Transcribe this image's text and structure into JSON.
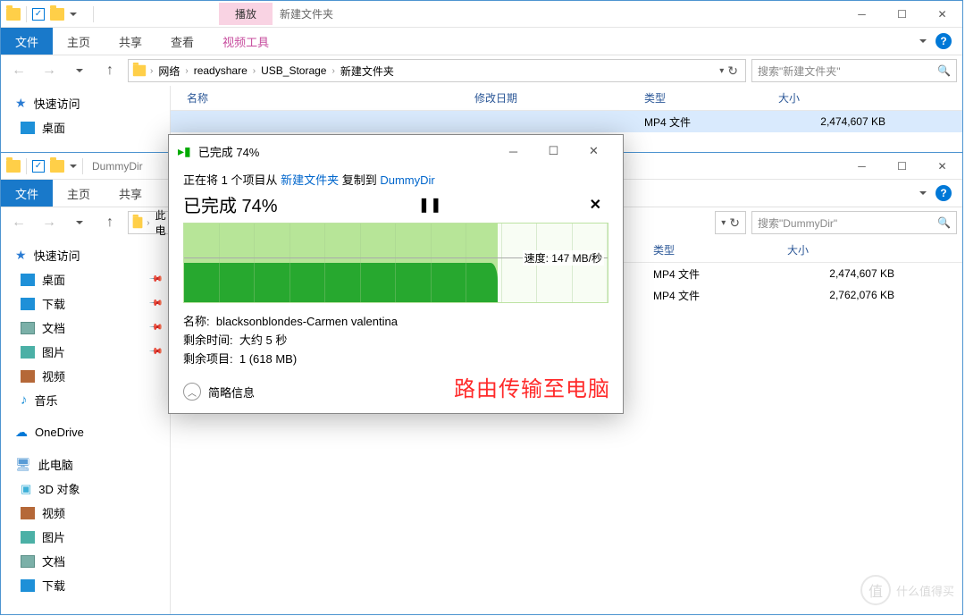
{
  "w1": {
    "context_tab": "播放",
    "context_group": "视频工具",
    "title": "新建文件夹",
    "tabs": {
      "file": "文件",
      "home": "主页",
      "share": "共享",
      "view": "查看",
      "video_tools": "视频工具"
    },
    "breadcrumb": [
      "网络",
      "readyshare",
      "USB_Storage",
      "新建文件夹"
    ],
    "search_placeholder": "搜索\"新建文件夹\"",
    "columns": {
      "name": "名称",
      "date": "修改日期",
      "type": "类型",
      "size": "大小"
    },
    "rows": [
      {
        "type": "MP4 文件",
        "size": "2,474,607 KB"
      }
    ],
    "sidebar": {
      "quick": "快速访问",
      "desktop": "桌面"
    }
  },
  "w2": {
    "title": "DummyDir",
    "tabs": {
      "file": "文件",
      "home": "主页",
      "share": "共享"
    },
    "breadcrumb_first": "此电",
    "search_placeholder": "搜索\"DummyDir\"",
    "columns": {
      "type": "类型",
      "size": "大小"
    },
    "rows": [
      {
        "type": "MP4 文件",
        "size": "2,474,607 KB"
      },
      {
        "type": "MP4 文件",
        "size": "2,762,076 KB"
      }
    ],
    "sidebar": {
      "quick": "快速访问",
      "desktop": "桌面",
      "downloads": "下载",
      "documents": "文档",
      "pictures": "图片",
      "videos": "视频",
      "music": "音乐",
      "onedrive": "OneDrive",
      "thispc": "此电脑",
      "threed": "3D 对象",
      "videos2": "视频",
      "pictures2": "图片",
      "documents2": "文档",
      "downloads2": "下载"
    }
  },
  "dlg": {
    "title": "已完成 74%",
    "copying_prefix": "正在将 1 个项目从 ",
    "src": "新建文件夹",
    "copying_mid": " 复制到 ",
    "dst": "DummyDir",
    "percent": "已完成 74%",
    "speed": "速度: 147 MB/秒",
    "name_lbl": "名称:",
    "name_val": "blacksonblondes-Carmen valentina",
    "time_lbl": "剩余时间:",
    "time_val": "大约 5 秒",
    "items_lbl": "剩余项目:",
    "items_val": "1 (618 MB)",
    "details": "简略信息",
    "annotation": "路由传输至电脑"
  },
  "watermark": "什么值得买"
}
